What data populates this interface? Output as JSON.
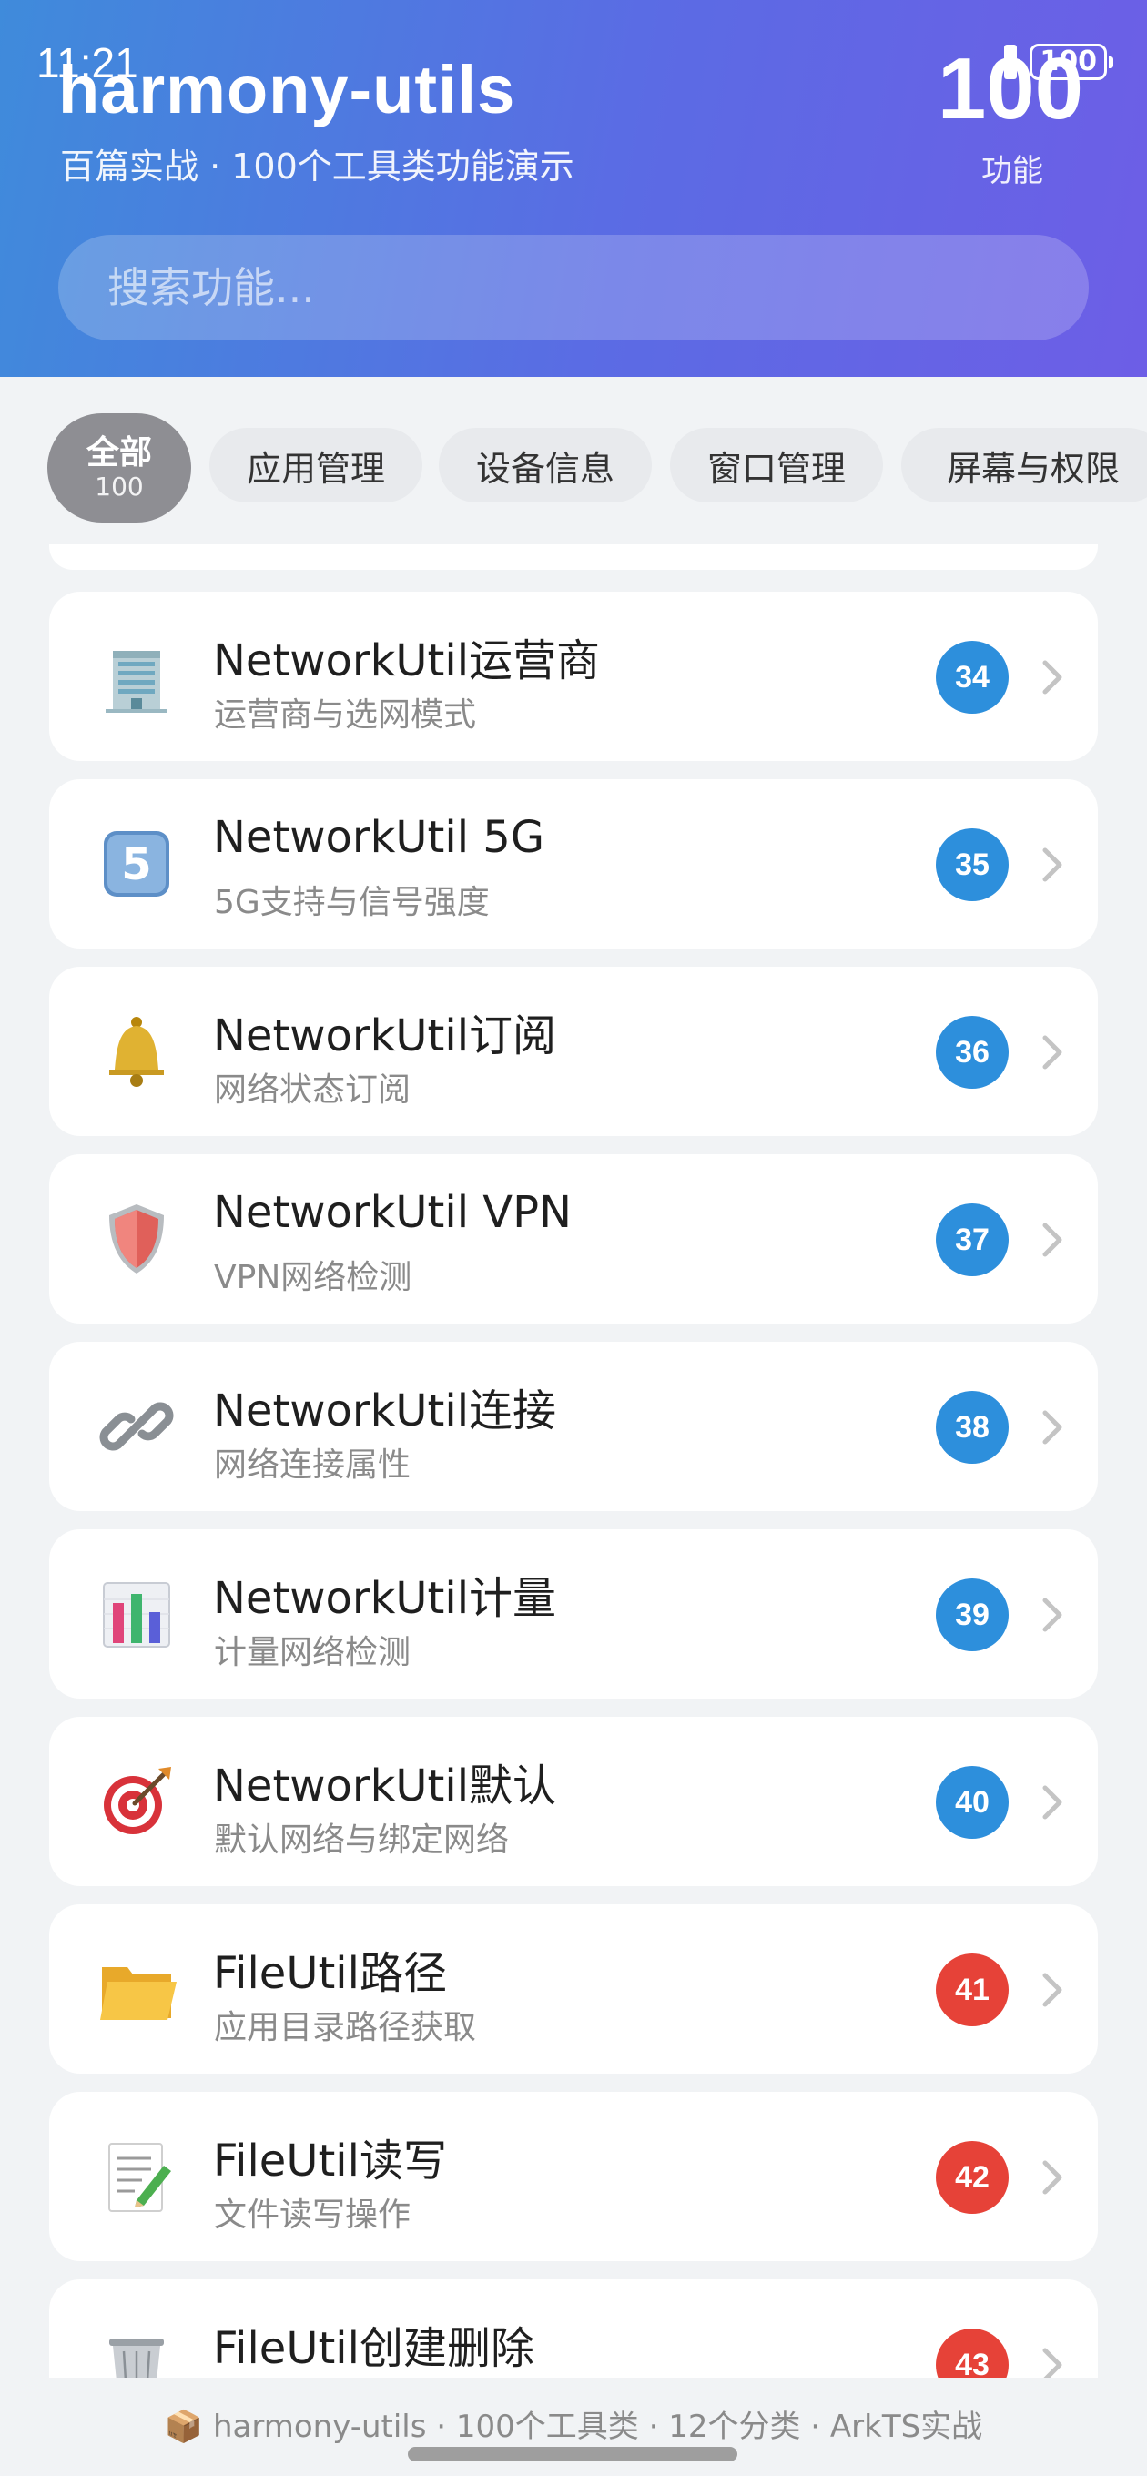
{
  "status": {
    "time": "11:21",
    "battery": "100"
  },
  "header": {
    "title": "harmony-utils",
    "subtitle": "百篇实战 · 100个工具类功能演示",
    "count": "100",
    "count_label": "功能"
  },
  "search": {
    "placeholder": "搜索功能..."
  },
  "tabs": [
    {
      "label": "全部",
      "count": "100",
      "active": true
    },
    {
      "label": "应用管理"
    },
    {
      "label": "设备信息"
    },
    {
      "label": "窗口管理"
    },
    {
      "label": "屏幕与权限"
    }
  ],
  "items": [
    {
      "icon": "office-building-icon",
      "title": "NetworkUtil运营商",
      "desc": "运营商与选网模式",
      "num": "34",
      "color": "#2d8fdc"
    },
    {
      "icon": "keycap-five-icon",
      "title": "NetworkUtil 5G",
      "desc": "5G支持与信号强度",
      "num": "35",
      "color": "#2d8fdc"
    },
    {
      "icon": "bell-icon",
      "title": "NetworkUtil订阅",
      "desc": "网络状态订阅",
      "num": "36",
      "color": "#2d8fdc"
    },
    {
      "icon": "shield-icon",
      "title": "NetworkUtil VPN",
      "desc": "VPN网络检测",
      "num": "37",
      "color": "#2d8fdc"
    },
    {
      "icon": "link-icon",
      "title": "NetworkUtil连接",
      "desc": "网络连接属性",
      "num": "38",
      "color": "#2d8fdc"
    },
    {
      "icon": "bar-chart-icon",
      "title": "NetworkUtil计量",
      "desc": "计量网络检测",
      "num": "39",
      "color": "#2d8fdc"
    },
    {
      "icon": "target-icon",
      "title": "NetworkUtil默认",
      "desc": "默认网络与绑定网络",
      "num": "40",
      "color": "#2d8fdc"
    },
    {
      "icon": "folder-icon",
      "title": "FileUtil路径",
      "desc": "应用目录路径获取",
      "num": "41",
      "color": "#e64238"
    },
    {
      "icon": "memo-icon",
      "title": "FileUtil读写",
      "desc": "文件读写操作",
      "num": "42",
      "color": "#e64238"
    },
    {
      "icon": "wastebasket-icon",
      "title": "FileUtil创建删除",
      "desc": "",
      "num": "43",
      "color": "#e64238"
    }
  ],
  "footer": {
    "text": "📦 harmony-utils · 100个工具类 · 12个分类 · ArkTS实战"
  }
}
